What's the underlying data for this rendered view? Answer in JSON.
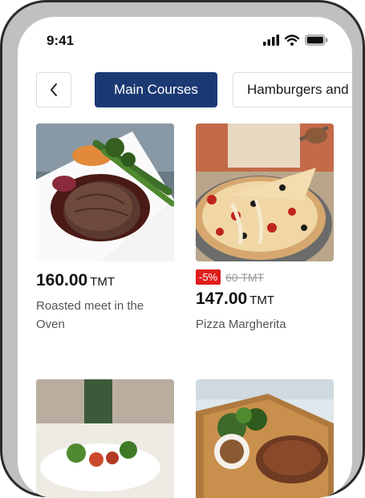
{
  "status_bar": {
    "time": "9:41"
  },
  "categories": {
    "active": "Main Courses",
    "next": "Hamburgers and Burgers"
  },
  "products": [
    {
      "price": "160.00",
      "currency": "TMT",
      "name": "Roasted meet in the Oven"
    },
    {
      "discount": "-5%",
      "old_price": "60 TMT",
      "price": "147.00",
      "currency": "TMT",
      "name": "Pizza Margherita"
    }
  ],
  "colors": {
    "primary": "#1b3a73",
    "discount": "#e01c1c"
  },
  "icons": [
    "chevron-left-icon",
    "signal-icon",
    "wifi-icon",
    "battery-icon"
  ]
}
